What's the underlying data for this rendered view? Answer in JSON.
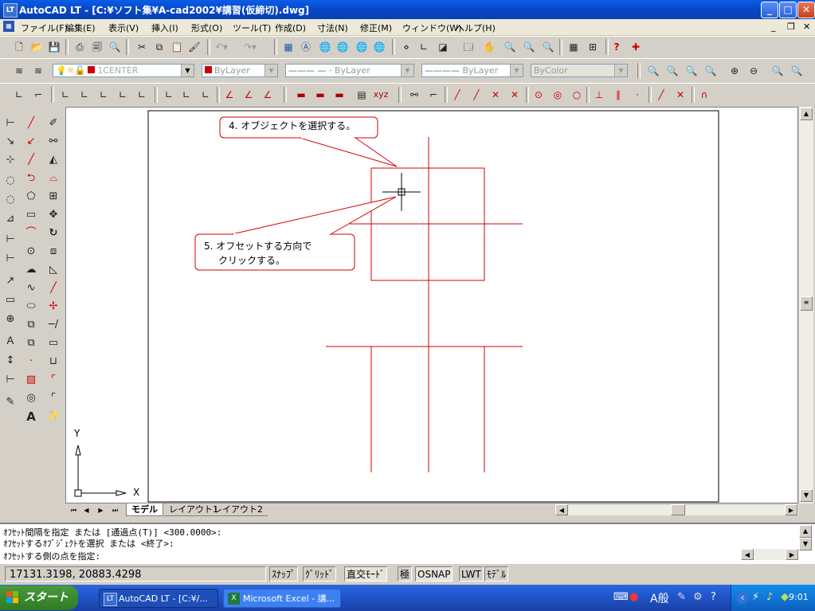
{
  "window": {
    "title": "AutoCAD LT - [C:¥ソフト集¥A-cad2002¥講習(仮締切).dwg]",
    "app_icon": "LT"
  },
  "menu": {
    "items": [
      "ファイル(F)",
      "編集(E)",
      "表示(V)",
      "挿入(I)",
      "形式(O)",
      "ツール(T)",
      "作成(D)",
      "寸法(N)",
      "修正(M)",
      "ウィンドウ(W)",
      "ヘルプ(H)"
    ]
  },
  "layers": {
    "current_layer": "1CENTER",
    "color": "ByLayer",
    "linetype": "ByLayer",
    "lineweight": "ByLayer",
    "plotstyle": "ByColor",
    "layer_color_hex": "#cc0000"
  },
  "drawing": {
    "callouts": [
      {
        "lines": [
          "4. オブジェクトを選択する。"
        ]
      },
      {
        "lines": [
          "5. オフセットする方向で",
          "クリックする。"
        ]
      }
    ],
    "ucs": {
      "x_label": "X",
      "y_label": "Y"
    },
    "line_color": "#d40000"
  },
  "layout_tabs": [
    "モデル",
    "レイアウト1",
    "レイアウト2"
  ],
  "command_lines": [
    "ｵﾌｾｯﾄ間隔を指定 または [通過点(T)] <300.0000>:",
    "ｵﾌｾｯﾄするｵﾌﾞｼﾞｪｸﾄを選択 または <終了>:",
    "ｵﾌｾｯﾄする側の点を指定:"
  ],
  "status": {
    "coordinates": "17131.3198, 20883.4298",
    "toggles": [
      "ｽﾅｯﾌﾟ",
      "ｸﾞﾘｯﾄﾞ",
      "直交ﾓｰﾄﾞ",
      "極",
      "OSNAP",
      "LWT",
      "ﾓﾃﾞﾙ"
    ]
  },
  "taskbar": {
    "start_label": "スタート",
    "tasks": [
      {
        "label": "AutoCAD LT - [C:¥/...",
        "active": true
      },
      {
        "label": "Microsoft Excel - 講...",
        "active": false
      }
    ],
    "ime": "A般",
    "clock": "9:01"
  }
}
